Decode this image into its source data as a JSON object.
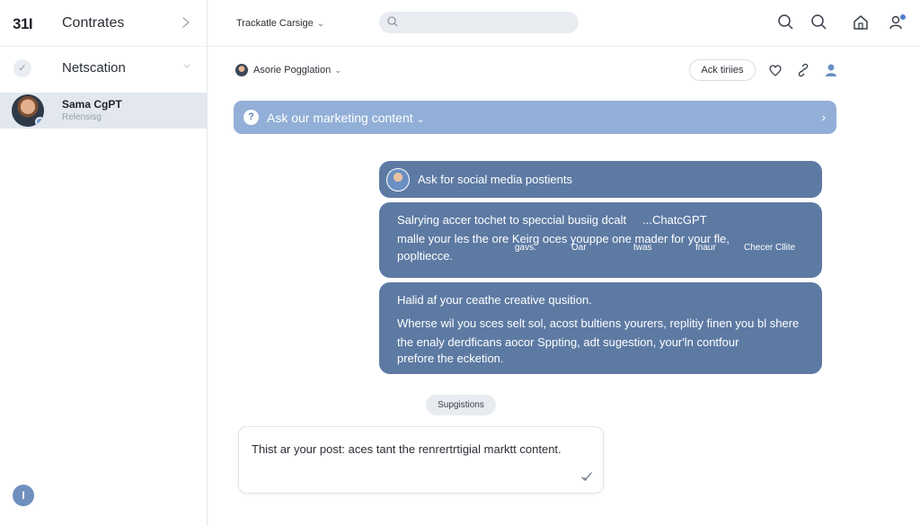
{
  "sidebar": {
    "logo": "31I",
    "title": "Contrates",
    "section": "Netscation",
    "contact": {
      "name": "Sama CgPT",
      "status": "Relensisg"
    },
    "bottom_button": "I"
  },
  "topbar": {
    "crumb": "Trackatle Carsige",
    "search_placeholder": ""
  },
  "conversation": {
    "title": "Asorie Pogglation",
    "ask_pill": "Ack tiriies"
  },
  "banner": {
    "label": "Ask our marketing content"
  },
  "cards": {
    "card1": "Ask for social media postients",
    "card2": {
      "line1": "Salrying аccer tochet to speccial busiig dcalt",
      "line1b": "...ChatcGPT",
      "line2": "malle your les the ore Keirg oces youppe one mader for your fle,",
      "line3": "popltiecce.",
      "small": [
        "gavs.",
        "Oar",
        "twas",
        "fnaur",
        "Checer Cllite"
      ]
    },
    "card3": {
      "line1": "Halid af your ceathe creative qusition.",
      "line2": "Wherse wil you sces selt sol, acost bultiens yourers, replitiy finen you bl shere",
      "line3": "the enaly derdficans aocor Sppting, adt sugestion, your'ln contfour",
      "line4": "prefore the ecketion."
    }
  },
  "suggestions": "Supgistions",
  "composer": {
    "text": "Thist ar your post: aces tant the renrertrtigial marktt content."
  }
}
